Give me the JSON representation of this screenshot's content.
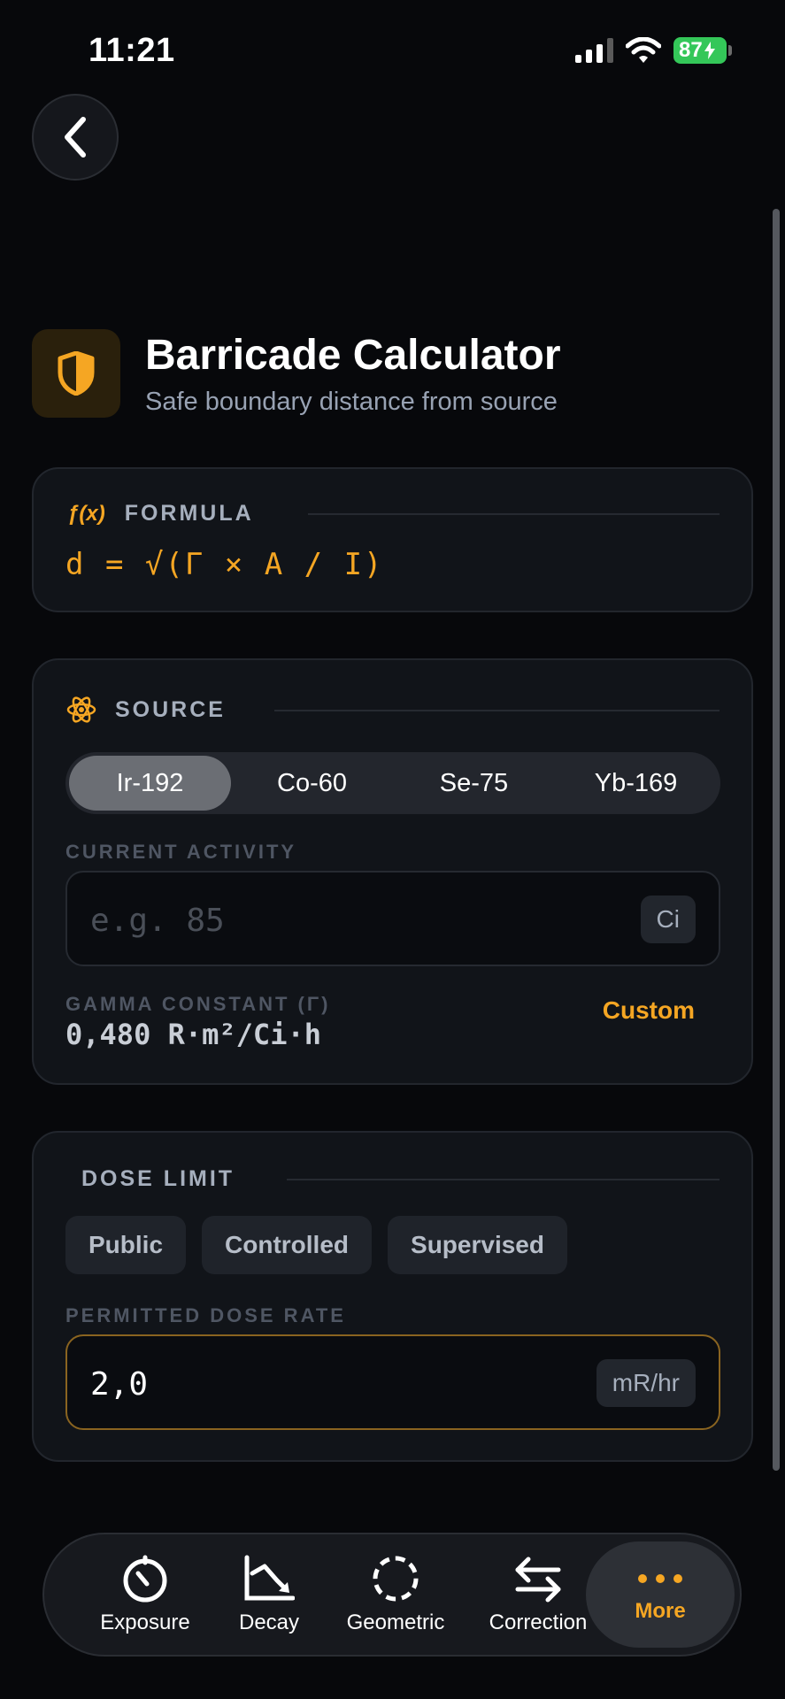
{
  "status": {
    "time": "11:21",
    "battery": "87"
  },
  "header": {
    "title": "Barricade Calculator",
    "subtitle": "Safe boundary distance from source"
  },
  "formula": {
    "icon_text": "ƒ(x)",
    "label": "FORMULA",
    "expression": "d = √(Γ × A / I)"
  },
  "source": {
    "label": "SOURCE",
    "isotopes": [
      "Ir-192",
      "Co-60",
      "Se-75",
      "Yb-169"
    ],
    "selected_index": 0,
    "activity_label": "CURRENT ACTIVITY",
    "activity_placeholder": "e.g. 85",
    "activity_unit": "Ci",
    "gamma_label": "GAMMA CONSTANT (Γ)",
    "gamma_value": "0,480 R·m²/Ci·h",
    "custom_label": "Custom"
  },
  "dose_limit": {
    "label": "DOSE LIMIT",
    "presets": [
      "Public",
      "Controlled",
      "Supervised"
    ],
    "rate_label": "PERMITTED DOSE RATE",
    "rate_value": "2,0",
    "rate_unit": "mR/hr"
  },
  "tabbar": {
    "items": [
      {
        "label": "Exposure",
        "icon": "timer-icon"
      },
      {
        "label": "Decay",
        "icon": "decay-chart-icon"
      },
      {
        "label": "Geometric",
        "icon": "dashed-circle-icon"
      },
      {
        "label": "Correction",
        "icon": "swap-arrows-icon"
      },
      {
        "label": "More",
        "icon": "more-dots-icon"
      }
    ],
    "active_index": 4
  },
  "colors": {
    "accent": "#f5a623",
    "background": "#07080b",
    "card": "#111419"
  }
}
